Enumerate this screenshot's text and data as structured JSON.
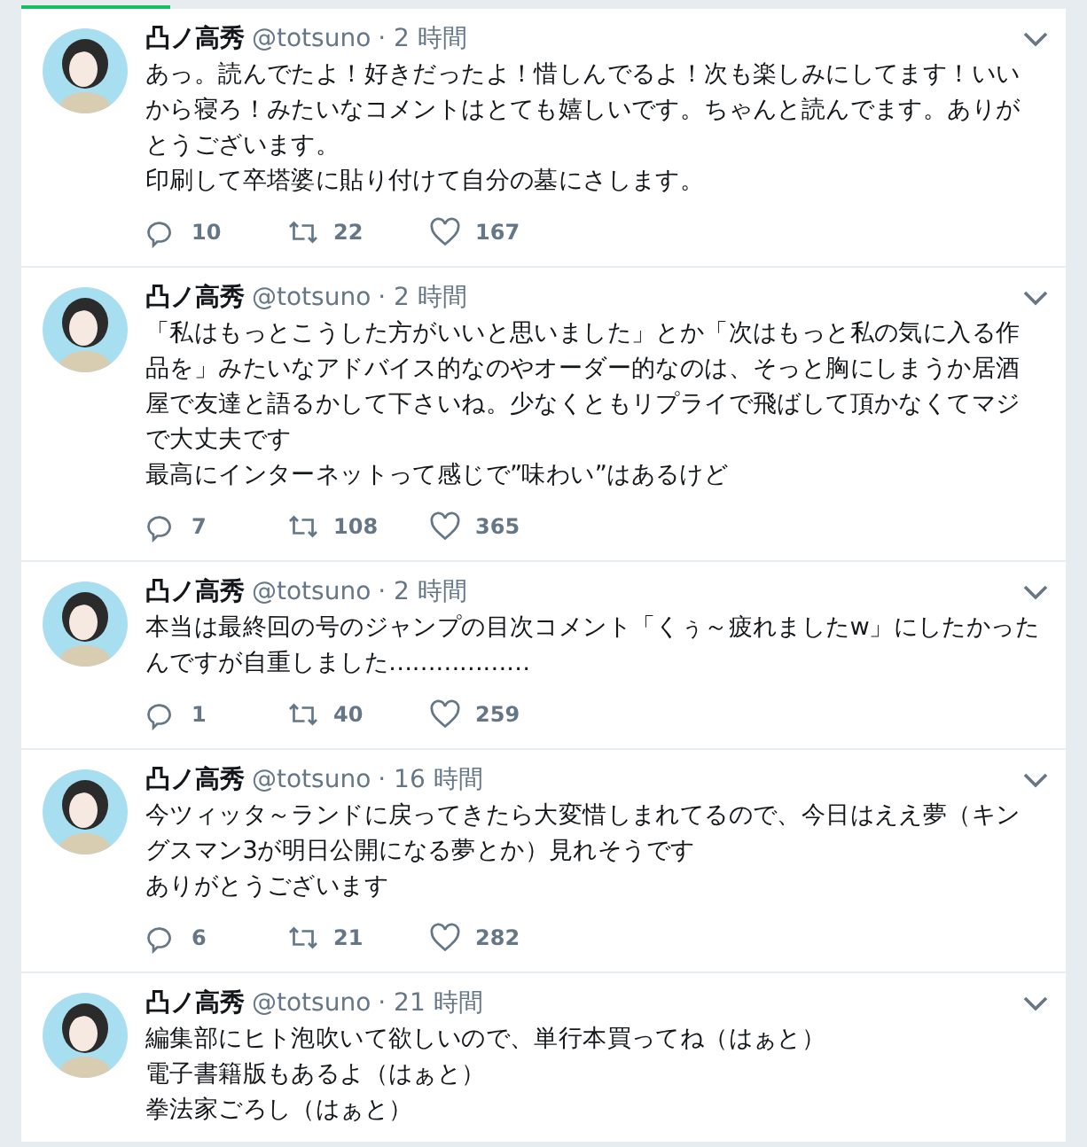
{
  "tweets": [
    {
      "name": "凸ノ高秀",
      "handle": "@totsuno",
      "time": "· 2 時間",
      "lines": [
        "あっ。読んでたよ！好きだったよ！惜しんでるよ！次も楽しみにしてます！いいから寝ろ！みたいなコメントはとても嬉しいです。ちゃんと読んでます。ありがとうございます。",
        "印刷して卒塔婆に貼り付けて自分の墓にさします。"
      ],
      "actions": {
        "replies": "10",
        "retweets": "22",
        "likes": "167"
      }
    },
    {
      "name": "凸ノ高秀",
      "handle": "@totsuno",
      "time": "· 2 時間",
      "lines": [
        "「私はもっとこうした方がいいと思いました」とか「次はもっと私の気に入る作品を」みたいなアドバイス的なのやオーダー的なのは、そっと胸にしまうか居酒屋で友達と語るかして下さいね。少なくともリプライで飛ばして頂かなくてマジで大丈夫です",
        "最高にインターネットって感じで”味わい”はあるけど"
      ],
      "actions": {
        "replies": "7",
        "retweets": "108",
        "likes": "365"
      }
    },
    {
      "name": "凸ノ高秀",
      "handle": "@totsuno",
      "time": "· 2 時間",
      "lines": [
        "本当は最終回の号のジャンプの目次コメント「くぅ～疲れましたw」にしたかったんですが自重しました………………"
      ],
      "actions": {
        "replies": "1",
        "retweets": "40",
        "likes": "259"
      }
    },
    {
      "name": "凸ノ高秀",
      "handle": "@totsuno",
      "time": "· 16 時間",
      "lines": [
        "今ツィッタ～ランドに戻ってきたら大変惜しまれてるので、今日はええ夢（キングスマン3が明日公開になる夢とか）見れそうです",
        "ありがとうございます"
      ],
      "actions": {
        "replies": "6",
        "retweets": "21",
        "likes": "282"
      }
    },
    {
      "name": "凸ノ高秀",
      "handle": "@totsuno",
      "time": "· 21 時間",
      "lines": [
        "編集部にヒト泡吹いて欲しいので、単行本買ってね（はぁと）",
        "電子書籍版もあるよ（はぁと）",
        "拳法家ごろし（はぁと）"
      ]
    }
  ]
}
